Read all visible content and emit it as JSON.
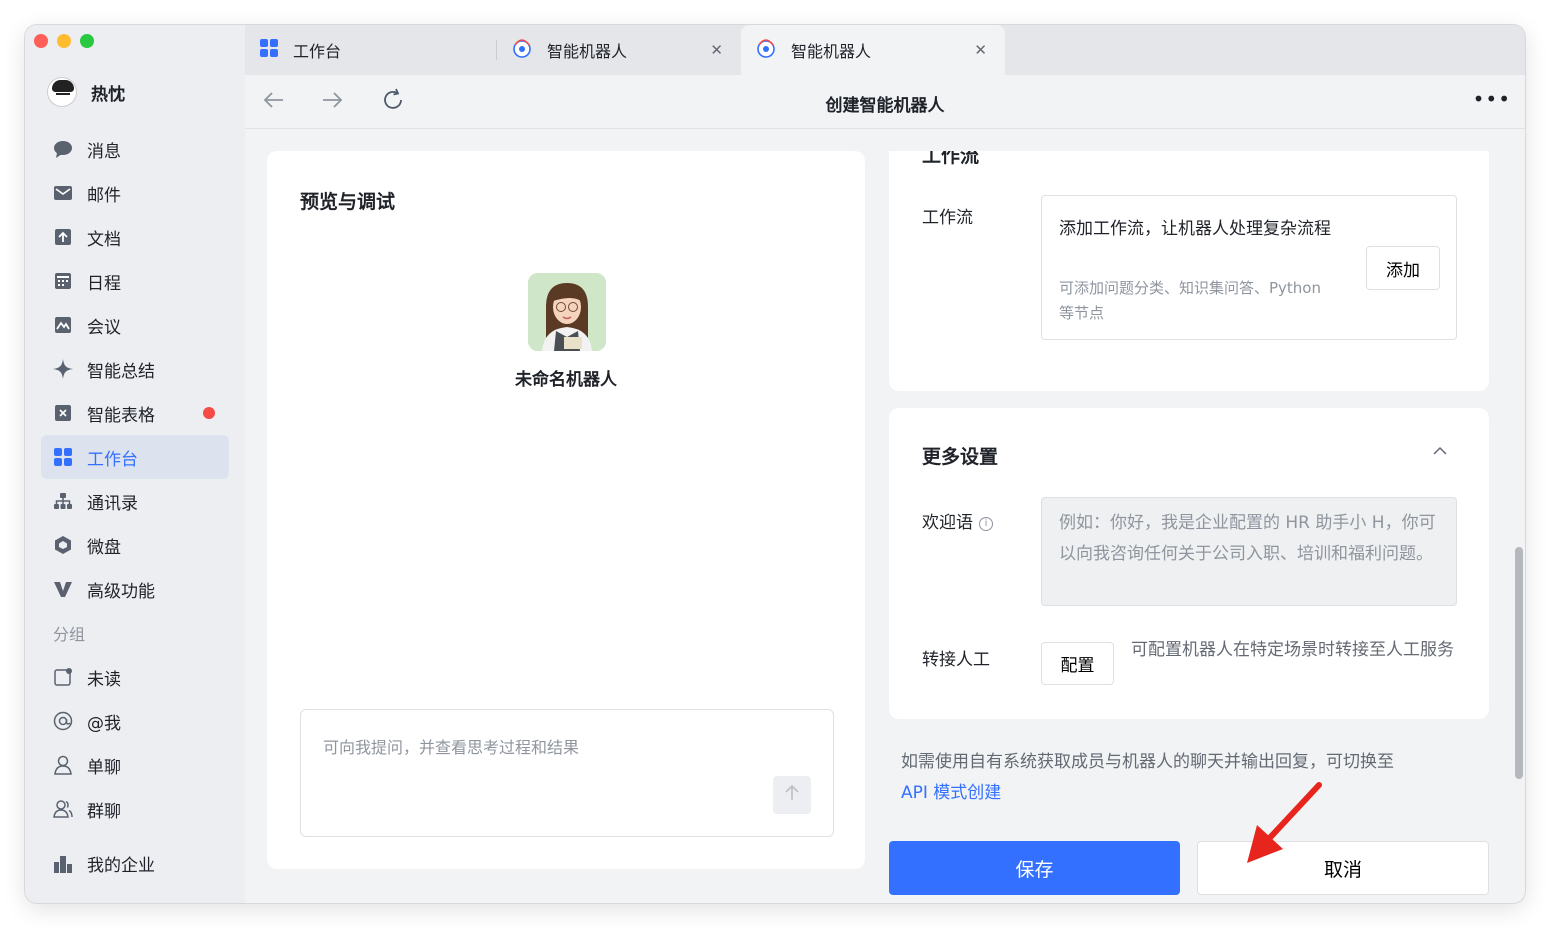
{
  "colors": {
    "accent": "#3370ff",
    "traffic_red": "#ff5f57",
    "traffic_yellow": "#febc2e",
    "traffic_green": "#28c840",
    "badge_red": "#f54a45",
    "annotation_arrow": "#e8251c"
  },
  "user": {
    "name": "热忱"
  },
  "sidebar": {
    "items": [
      {
        "label": "消息",
        "icon": "chat-bubble-icon"
      },
      {
        "label": "邮件",
        "icon": "mail-icon"
      },
      {
        "label": "文档",
        "icon": "document-icon"
      },
      {
        "label": "日程",
        "icon": "calendar-icon"
      },
      {
        "label": "会议",
        "icon": "meeting-icon"
      },
      {
        "label": "智能总结",
        "icon": "sparkle-icon"
      },
      {
        "label": "智能表格",
        "icon": "smart-sheet-icon"
      },
      {
        "label": "工作台",
        "icon": "workbench-grid-icon"
      },
      {
        "label": "通讯录",
        "icon": "contacts-icon"
      },
      {
        "label": "微盘",
        "icon": "drive-icon"
      },
      {
        "label": "高级功能",
        "icon": "advanced-v-icon"
      }
    ],
    "group_label": "分组",
    "groups": [
      {
        "label": "未读",
        "icon": "unread-icon"
      },
      {
        "label": "@我",
        "icon": "at-icon"
      },
      {
        "label": "单聊",
        "icon": "single-chat-icon"
      },
      {
        "label": "群聊",
        "icon": "group-chat-icon"
      }
    ],
    "enterprise_label": "我的企业"
  },
  "tabs": [
    {
      "label": "工作台",
      "icon": "workbench-grid-icon"
    },
    {
      "label": "智能机器人",
      "icon": "robot-icon"
    },
    {
      "label": "智能机器人",
      "icon": "robot-icon"
    }
  ],
  "toolbar": {
    "title": "创建智能机器人"
  },
  "preview": {
    "title": "预览与调试",
    "bot_name": "未命名机器人",
    "input_placeholder": "可向我提问，并查看思考过程和结果"
  },
  "workflow": {
    "section_title": "工作流",
    "label": "工作流",
    "box_title": "添加工作流，让机器人处理复杂流程",
    "box_desc": "可添加问题分类、知识集问答、Python等节点",
    "add_button": "添加"
  },
  "more_settings": {
    "title": "更多设置",
    "welcome_label": "欢迎语",
    "welcome_placeholder": "例如：你好，我是企业配置的 HR 助手小 H，你可以向我咨询任何关于公司入职、培训和福利问题。",
    "transfer_label": "转接人工",
    "configure_button": "配置",
    "transfer_desc": "可配置机器人在特定场景时转接至人工服务"
  },
  "api_note": {
    "text": "如需使用自有系统获取成员与机器人的聊天并输出回复，可切换至",
    "link": "API 模式创建"
  },
  "actions": {
    "save": "保存",
    "cancel": "取消"
  }
}
